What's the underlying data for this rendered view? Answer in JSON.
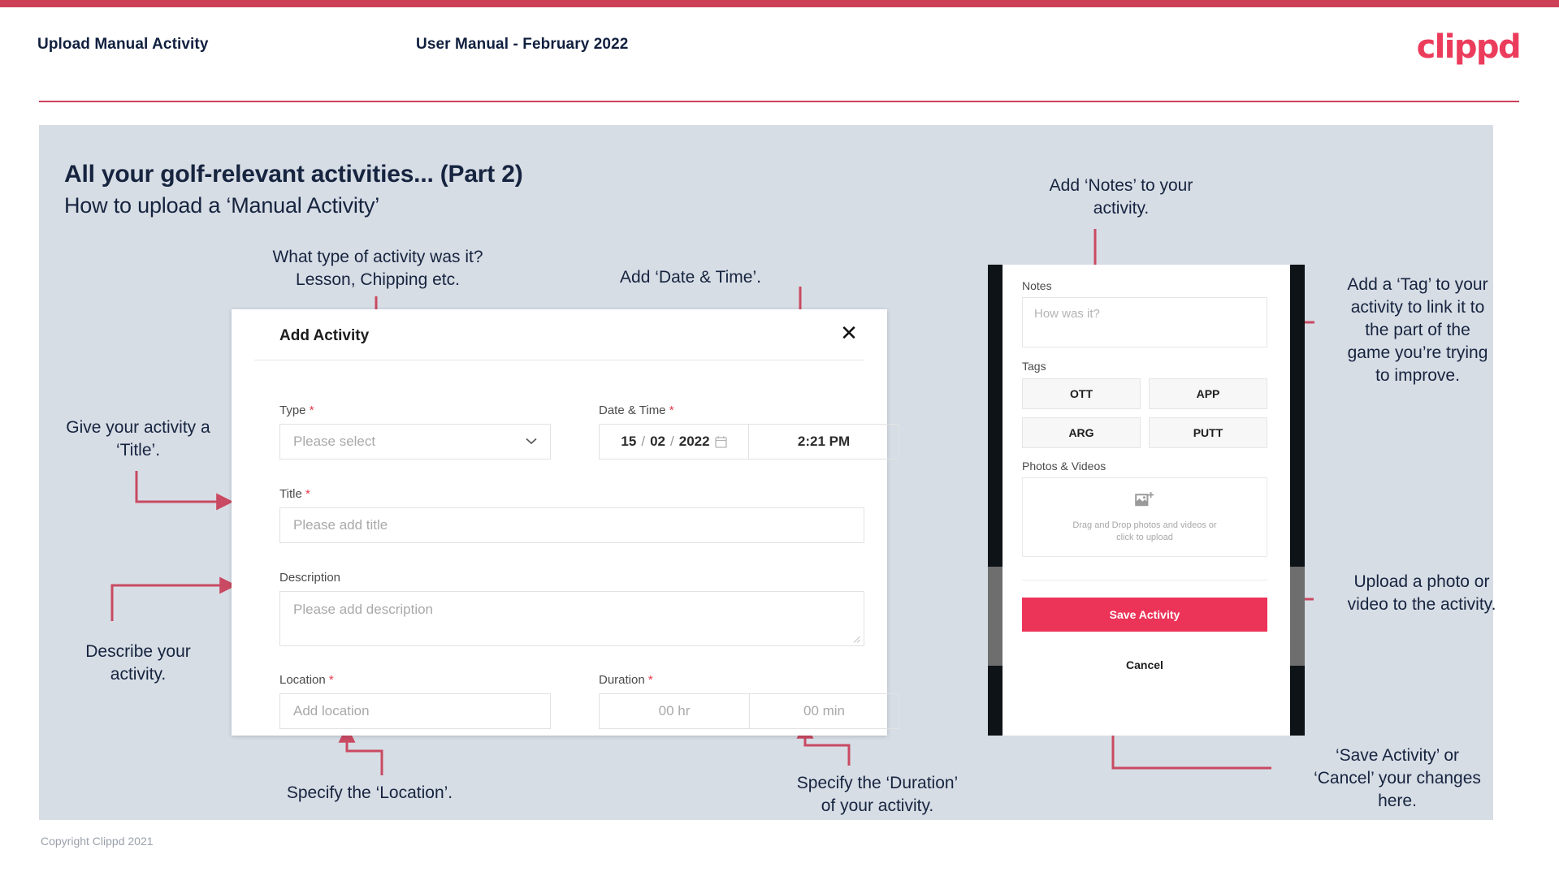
{
  "header": {
    "title": "Upload Manual Activity",
    "subtitle": "User Manual - February 2022",
    "logo": "clippd"
  },
  "slide": {
    "title": "All your golf-relevant activities... (Part 2)",
    "subtitle": "How to upload a ‘Manual Activity’",
    "footer": "Copyright Clippd 2021"
  },
  "modal": {
    "title": "Add Activity",
    "close_icon": "✕",
    "fields": {
      "type": {
        "label": "Type",
        "required": "*",
        "placeholder": "Please select",
        "caret": "⌄"
      },
      "datetime": {
        "label": "Date & Time",
        "required": "*",
        "day": "15",
        "month": "02",
        "year": "2022",
        "sep": "/",
        "time": "2:21 PM"
      },
      "title": {
        "label": "Title",
        "required": "*",
        "placeholder": "Please add title"
      },
      "description": {
        "label": "Description",
        "required": "",
        "placeholder": "Please add description"
      },
      "location": {
        "label": "Location",
        "required": "*",
        "placeholder": "Add location"
      },
      "duration": {
        "label": "Duration",
        "required": "*",
        "hours": "00 hr",
        "minutes": "00 min"
      }
    }
  },
  "phone": {
    "notes": {
      "label": "Notes",
      "placeholder": "How was it?"
    },
    "tags": {
      "label": "Tags",
      "items": [
        "OTT",
        "APP",
        "ARG",
        "PUTT"
      ]
    },
    "photos": {
      "label": "Photos & Videos",
      "drop_line1": "Drag and Drop photos and videos or",
      "drop_line2": "click to upload"
    },
    "save_label": "Save Activity",
    "cancel_label": "Cancel"
  },
  "annotations": {
    "type": "What type of activity was it?\nLesson, Chipping etc.",
    "datetime": "Add ‘Date & Time’.",
    "title": "Give your activity a\n‘Title’.",
    "description": "Describe your\nactivity.",
    "location": "Specify the ‘Location’.",
    "duration": "Specify the ‘Duration’\nof your activity.",
    "notes": "Add ‘Notes’ to your\nactivity.",
    "tags": "Add a ‘Tag’ to your\nactivity to link it to\nthe part of the\ngame you’re trying\nto improve.",
    "upload": "Upload a photo or\nvideo to the activity.",
    "save": "‘Save Activity’ or\n‘Cancel’ your changes\nhere."
  },
  "colors": {
    "accent": "#ec3c5c",
    "rule": "#cc4158",
    "slide_bg": "#d7dde5",
    "ink": "#16243f",
    "arrow": "#c94a62"
  }
}
